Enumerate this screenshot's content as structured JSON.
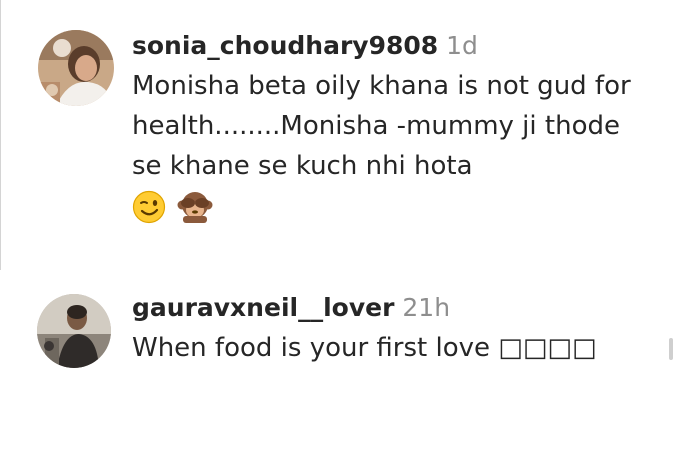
{
  "comments": [
    {
      "username": "sonia_choudhary9808",
      "time": "1d",
      "text": "Monisha beta oily khana is not gud for health........Monisha -mummy ji thode se khane se kuch nhi hota",
      "emojis": [
        "winking-face-emoji",
        "see-no-evil-monkey-emoji"
      ]
    },
    {
      "username": "gauravxneil__lover",
      "time": "21h",
      "text": "When food is your first love □□□□"
    }
  ],
  "colors": {
    "text": "#262626",
    "muted": "#8e8e8e",
    "background": "#ffffff"
  }
}
